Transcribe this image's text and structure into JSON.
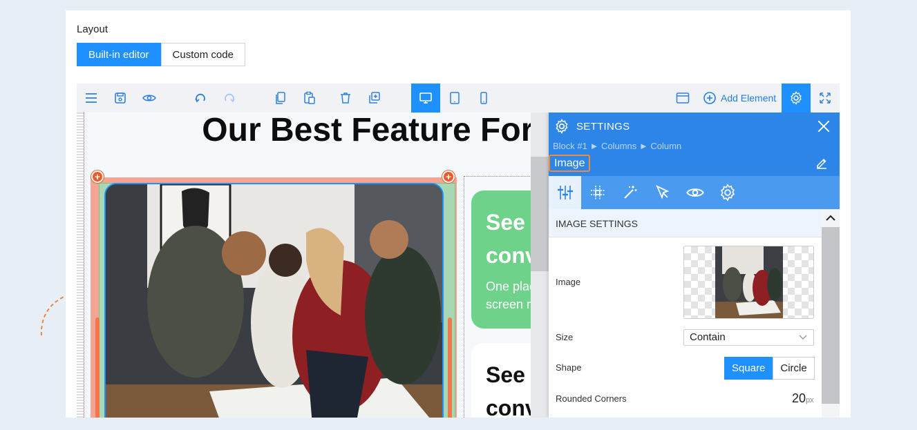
{
  "layout": {
    "label": "Layout",
    "modes": [
      {
        "label": "Built-in editor",
        "active": true
      },
      {
        "label": "Custom code",
        "active": false
      }
    ]
  },
  "toolbar": {
    "left_icons": [
      "menu-icon",
      "save-icon",
      "preview-icon",
      "undo-icon",
      "redo-icon",
      "copy-icon",
      "paste-icon",
      "delete-icon",
      "duplicate-icon"
    ],
    "device_icons": [
      "desktop-icon",
      "tablet-icon",
      "mobile-icon"
    ],
    "active_device": "desktop",
    "add_element_label": "Add Element",
    "right_icons": [
      "layout-icon",
      "gear-icon",
      "fullscreen-icon"
    ]
  },
  "canvas": {
    "headline": "Our Best Feature For Ho",
    "green_card": {
      "heading_1": "See",
      "heading_2": "conv",
      "body_1": "One plac",
      "body_2": "screen r"
    },
    "white_card": {
      "heading_1": "See",
      "heading_2": "conv"
    }
  },
  "settings": {
    "title": "SETTINGS",
    "breadcrumb": "Block #1 ► Columns ► Column",
    "element_name": "Image",
    "tabs": [
      "sliders-icon",
      "grid-icon",
      "magic-wand-icon",
      "pointer-icon",
      "eye-icon",
      "gear-icon"
    ],
    "active_tab": 0,
    "section_title": "IMAGE SETTINGS",
    "image_label": "Image",
    "size_label": "Size",
    "size_value": "Contain",
    "shape_label": "Shape",
    "shape_options": [
      {
        "label": "Square",
        "active": true
      },
      {
        "label": "Circle",
        "active": false
      }
    ],
    "rounded_label": "Rounded Corners",
    "rounded_value": "20",
    "rounded_unit": "px"
  },
  "colors": {
    "accent": "#1e90ff",
    "settings_header": "#2d85e8",
    "green_card": "#6fd28a",
    "column_orange": "#f4a493"
  }
}
